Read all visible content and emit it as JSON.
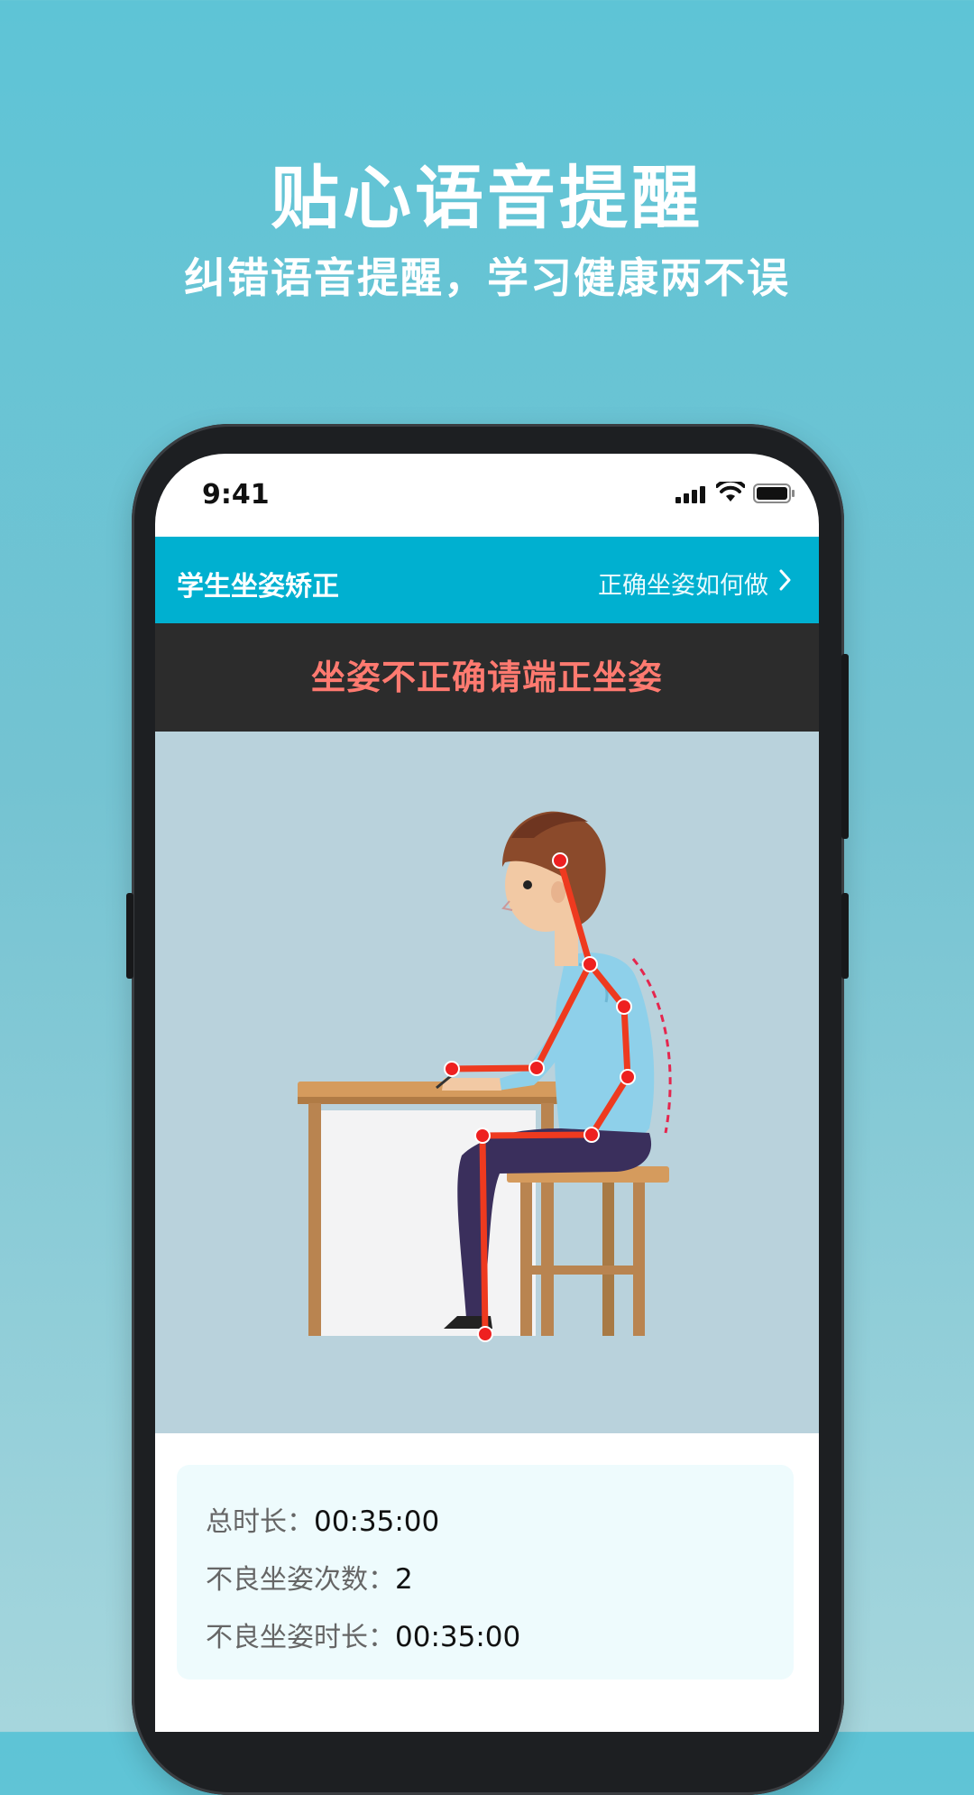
{
  "hero": {
    "title": "贴心语音提醒",
    "subtitle": "纠错语音提醒，学习健康两不误"
  },
  "status_bar": {
    "time": "9:41",
    "icons": [
      "signal-icon",
      "wifi-icon",
      "battery-icon"
    ]
  },
  "app_bar": {
    "title": "学生坐姿矫正",
    "link_label": "正确坐姿如何做",
    "link_icon": "chevron-right-icon"
  },
  "alert": {
    "message": "坐姿不正确请端正坐姿"
  },
  "stats": {
    "total_label": "总时长：",
    "total_value": "00:35:00",
    "bad_count_label": "不良坐姿次数：",
    "bad_count_value": "2",
    "bad_duration_label": "不良坐姿时长：",
    "bad_duration_value": "00:35:00"
  },
  "colors": {
    "accent": "#00b0d0",
    "alert_text": "#ff7a70",
    "skeleton": "#ee3a1f"
  }
}
